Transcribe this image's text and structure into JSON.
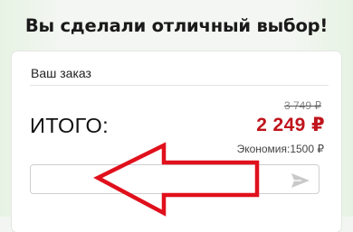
{
  "headline": "Вы сделали отличный выбор!",
  "order": {
    "title": "Ваш заказ",
    "old_price": "3 749 ₽",
    "total_label": "ИТОГО:",
    "total_price": "2 249 ₽",
    "savings": "Экономия:1500 ₽"
  },
  "promo": {
    "value": "",
    "placeholder": ""
  },
  "icons": {
    "send": "send-icon",
    "annotation": "red-arrow-annotation"
  },
  "colors": {
    "accent_price": "#c0141c",
    "annotation": "#e0101c",
    "send_icon": "#c9c9c9"
  }
}
